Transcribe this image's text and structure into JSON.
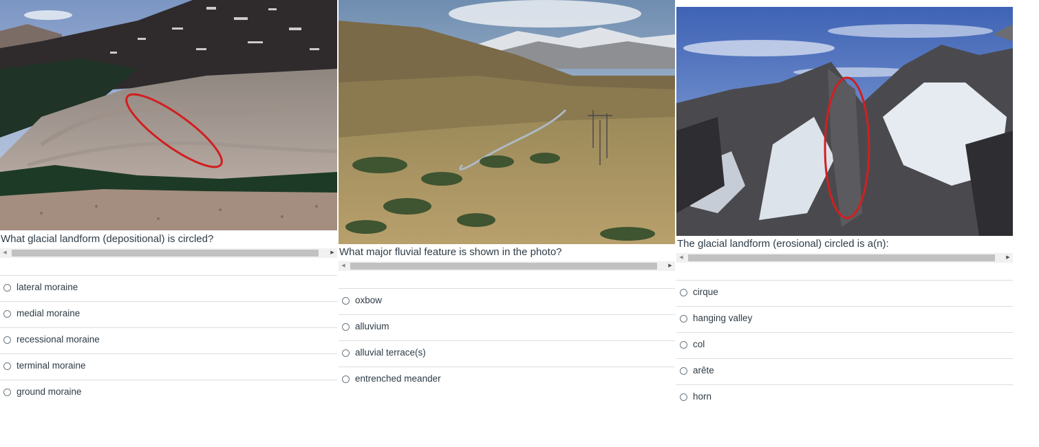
{
  "questions": [
    {
      "prompt": "What glacial landform (depositional) is circled?",
      "photo_icon": "moraine-photo",
      "answers": [
        "lateral moraine",
        "medial moraine",
        "recessional moraine",
        "terminal moraine",
        "ground moraine"
      ]
    },
    {
      "prompt": "What major fluvial feature is shown in the photo?",
      "photo_icon": "river-valley-photo",
      "answers": [
        "oxbow",
        "alluvium",
        "alluvial terrace(s)",
        "entrenched meander"
      ]
    },
    {
      "prompt": "The glacial landform (erosional) circled is a(n):",
      "photo_icon": "mountain-ridge-photo",
      "answers": [
        "cirque",
        "hanging valley",
        "col",
        "arête",
        "horn"
      ]
    }
  ],
  "scroll_arrows": {
    "left": "◀",
    "right": "▶"
  },
  "colors": {
    "circle_annotation": "#d21f1f",
    "divider": "#dadcde",
    "text": "#2d3b45"
  }
}
